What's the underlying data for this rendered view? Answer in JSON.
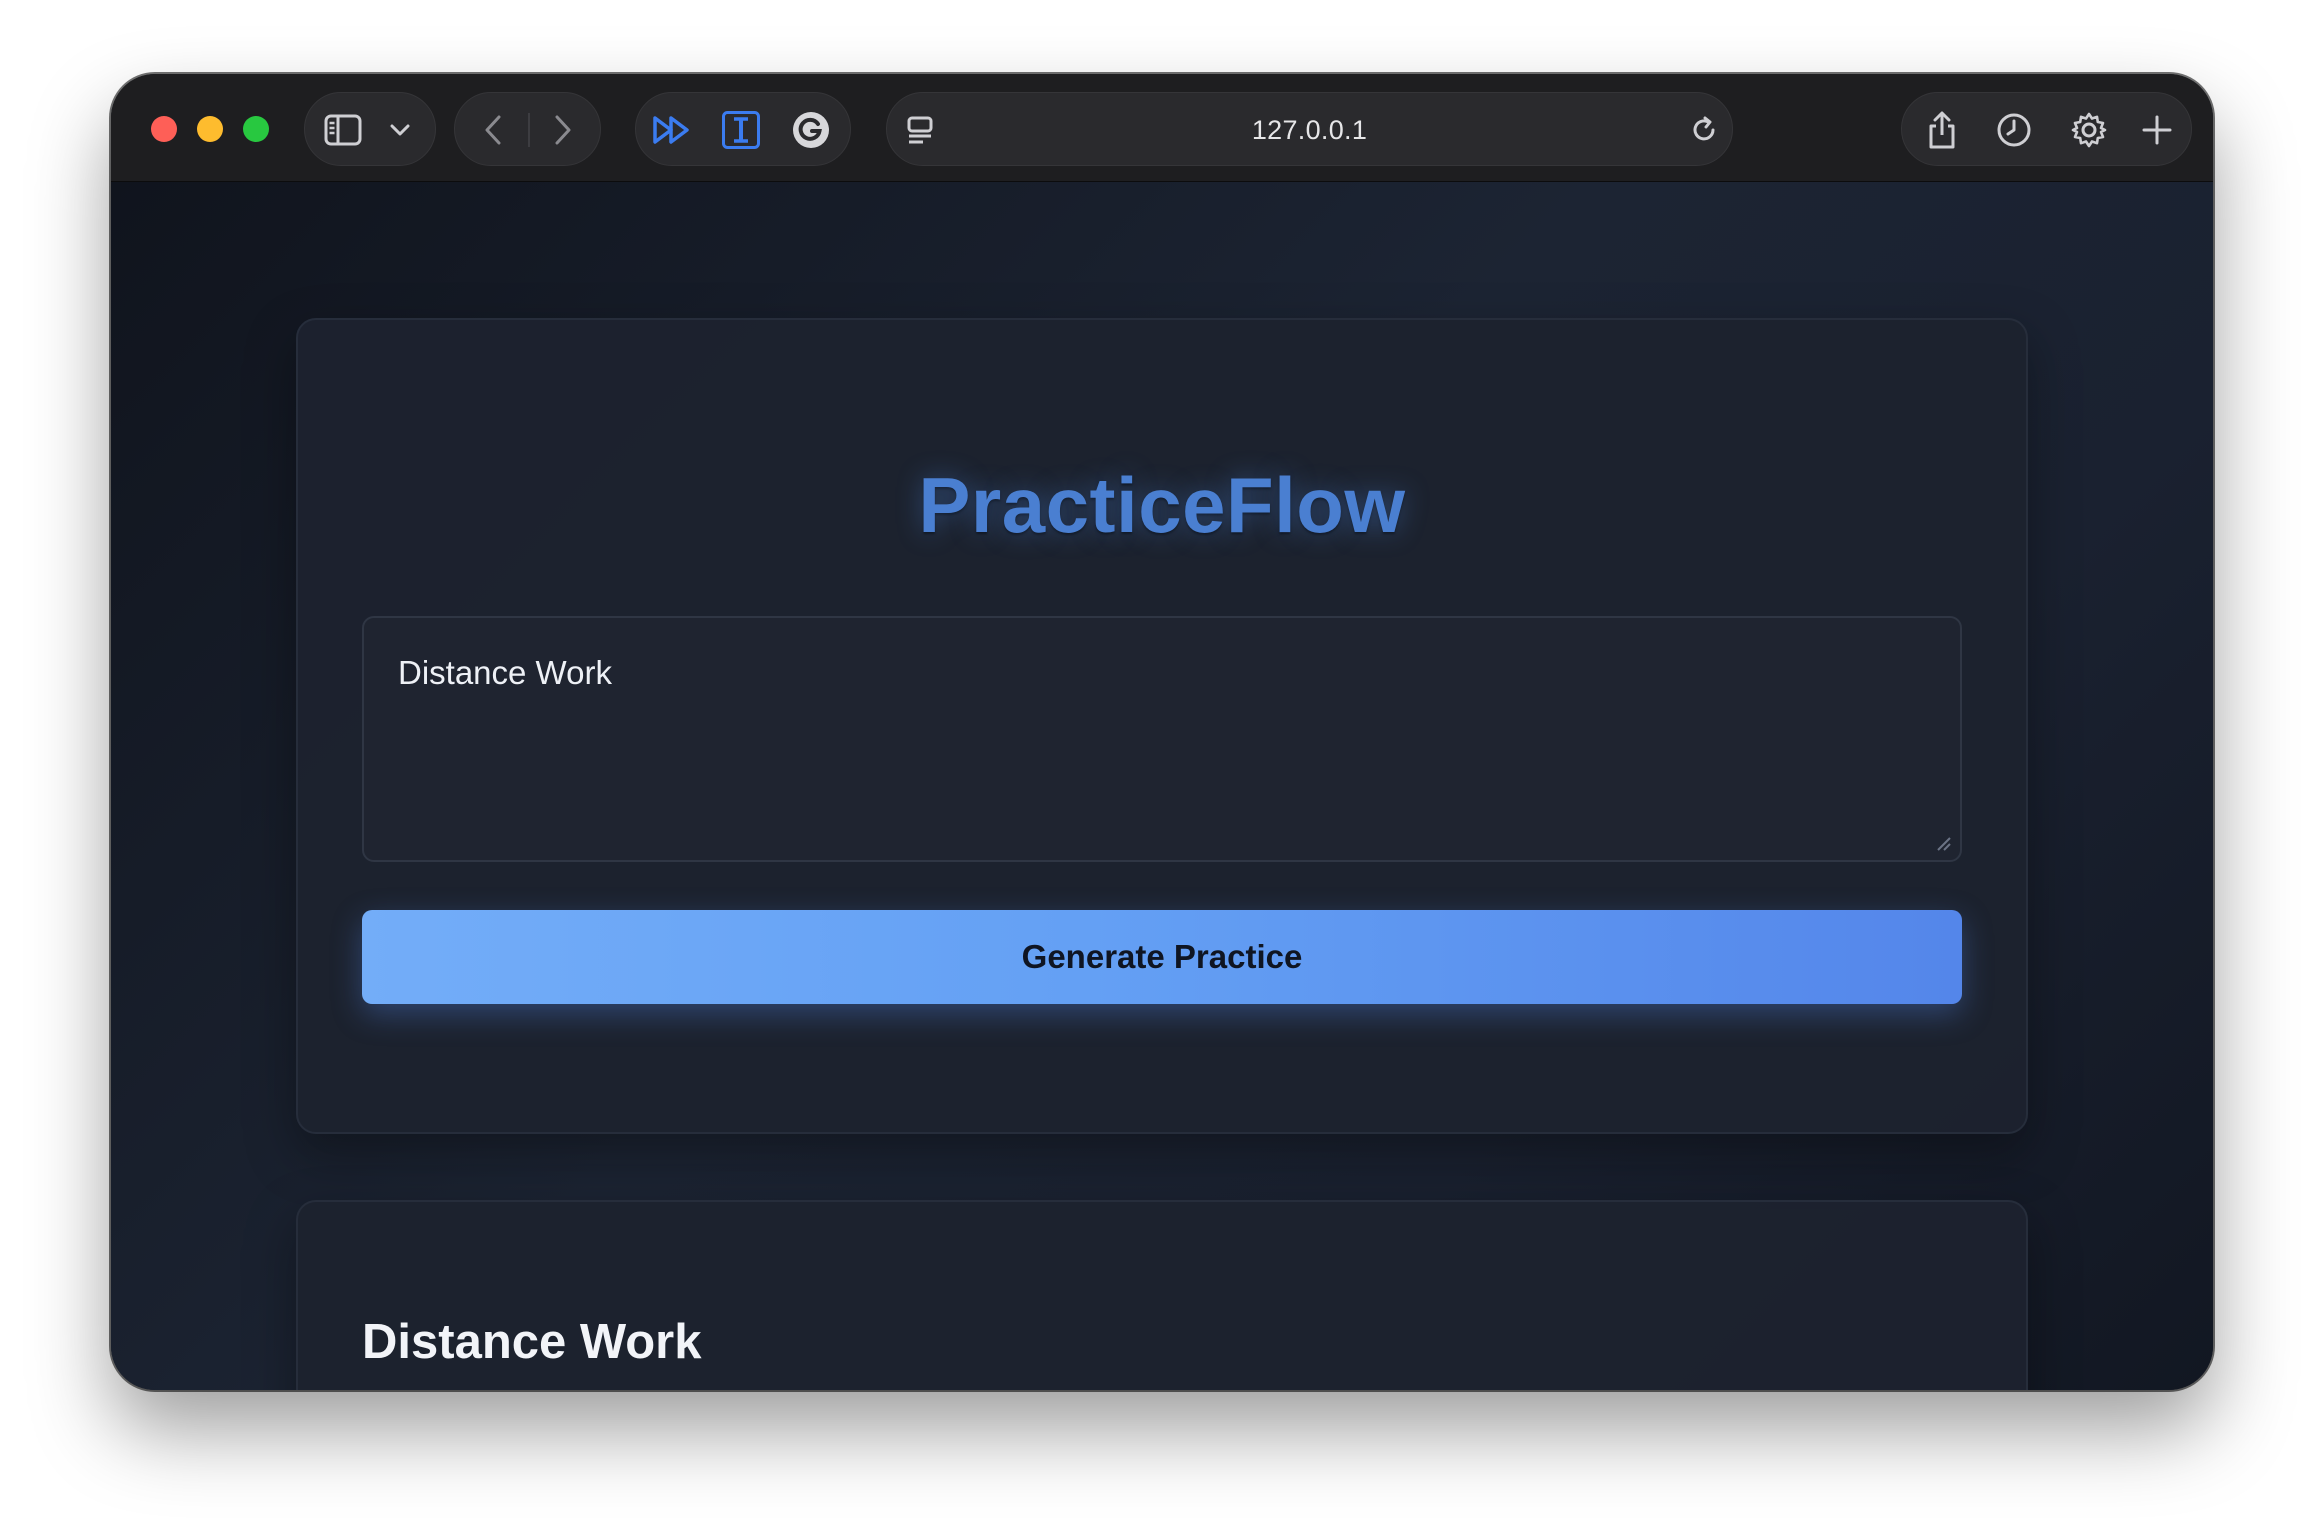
{
  "browser": {
    "url": "127.0.0.1",
    "icons": {
      "sidebar": "sidebar-toggle-icon",
      "sidebar_menu": "chevron-down-icon",
      "back": "chevron-left-icon",
      "forward": "chevron-right-icon",
      "ext1": "fast-forward-icon",
      "ext2": "text-cursor-icon",
      "ext3": "grammarly-g-icon",
      "page_menu": "page-format-icon",
      "reload": "reload-icon",
      "share": "share-icon",
      "history": "clock-icon",
      "settings": "gear-icon",
      "new_tab": "plus-icon"
    }
  },
  "app": {
    "title": "PracticeFlow",
    "input": {
      "value": "Distance Work"
    },
    "generate_label": "Generate Practice",
    "result": {
      "heading": "Distance Work"
    }
  },
  "colors": {
    "brand": "#4a7fd1",
    "button_gradient_start": "#73adf8",
    "button_gradient_end": "#5486ea",
    "card_bg": "#1d222e"
  }
}
